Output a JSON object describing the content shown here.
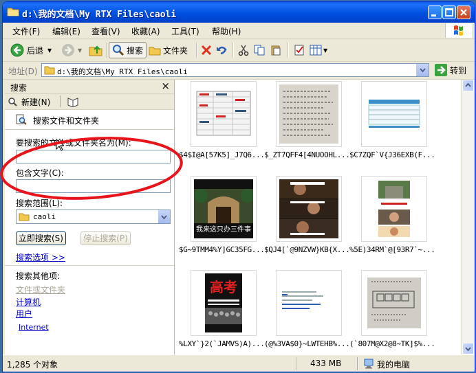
{
  "window": {
    "title": "d:\\我的文档\\My RTX Files\\caoli",
    "minimize_label": "minimize",
    "maximize_label": "maximize",
    "close_label": "close"
  },
  "menu": [
    {
      "label": "文件(F)"
    },
    {
      "label": "编辑(E)"
    },
    {
      "label": "查看(V)"
    },
    {
      "label": "收藏(A)"
    },
    {
      "label": "工具(T)"
    },
    {
      "label": "帮助(H)"
    }
  ],
  "toolbar": {
    "back_label": "后退",
    "search_label": "搜索",
    "folders_label": "文件夹"
  },
  "address": {
    "label": "地址(D)",
    "value": "d:\\我的文档\\My RTX Files\\caoli",
    "go_label": "转到"
  },
  "search_pane": {
    "title": "搜索",
    "new_label": "新建(N)",
    "heading": "搜索文件和文件夹",
    "name_label": "要搜索的文件或文件夹名为(M):",
    "name_value": "",
    "contains_label": "包含文字(C):",
    "contains_value": "",
    "lookin_label": "搜索范围(L):",
    "lookin_value": "caoli",
    "search_now": "立即搜索(S)",
    "stop_search": "停止搜索(P)",
    "options_link": "搜索选项 >>",
    "other_label": "搜索其他项:",
    "other_items": [
      "文件或文件夹",
      "计算机",
      "用户",
      "Internet"
    ]
  },
  "files": [
    {
      "name": "$4$I@A[57K5]_J7Q6..."
    },
    {
      "name": "$_ZT7QFF4[4NUOOHL..."
    },
    {
      "name": "$C7ZQF`V{J36EXB(F..."
    },
    {
      "name": "$G~9TMM4%Y]GC35FG..."
    },
    {
      "name": "$QJ4[`@9NZVW}KB{X..."
    },
    {
      "name": "%5E)34RM`@[93R7`~..."
    },
    {
      "name": "%LXY`}2(`JAMVS)A)..."
    },
    {
      "name": "(@%3VA$0}~LWTEHB%..."
    },
    {
      "name": "(`807M@X2@8~TK]$%..."
    }
  ],
  "thumb_captions": {
    "photo2": "我来这只办三件事",
    "poster": "高考"
  },
  "status": {
    "count": "1,285 个对象",
    "size": "433 MB",
    "location": "我的电脑"
  }
}
